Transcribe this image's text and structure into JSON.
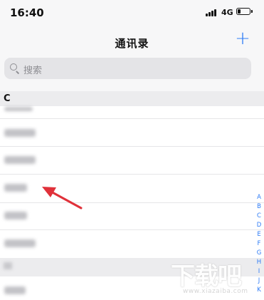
{
  "status_bar": {
    "time": "16:40",
    "network": "4G"
  },
  "nav": {
    "title": "通讯录",
    "add_symbol": "+"
  },
  "search": {
    "placeholder": "搜索"
  },
  "sections": [
    {
      "letter": "C"
    }
  ],
  "index_letters": [
    "A",
    "B",
    "C",
    "D",
    "E",
    "F",
    "G",
    "H",
    "I",
    "J",
    "K"
  ],
  "watermark": {
    "text": "下载吧",
    "url": "www.xiazaiba.com"
  },
  "colors": {
    "accent": "#2f7cf6",
    "arrow": "#e0313a",
    "section_bg": "#ececee"
  }
}
